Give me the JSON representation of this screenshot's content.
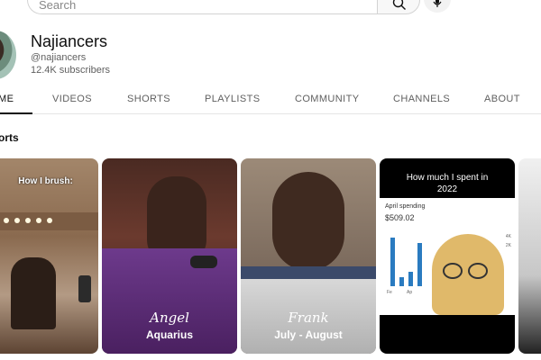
{
  "search": {
    "placeholder": "Search"
  },
  "channel": {
    "name": "Najiancers",
    "handle": "@najiancers",
    "subscribers": "12.4K subscribers"
  },
  "tabs": [
    {
      "label": "ME",
      "active": true
    },
    {
      "label": "VIDEOS",
      "active": false
    },
    {
      "label": "SHORTS",
      "active": false
    },
    {
      "label": "PLAYLISTS",
      "active": false
    },
    {
      "label": "COMMUNITY",
      "active": false
    },
    {
      "label": "CHANNELS",
      "active": false
    },
    {
      "label": "ABOUT",
      "active": false
    }
  ],
  "section": {
    "title": "orts"
  },
  "shorts": [
    {
      "overlay_top": "How I brush:"
    },
    {
      "overlay_script": "Angel",
      "overlay_bold": "Aquarius"
    },
    {
      "overlay_script": "Frank",
      "overlay_bold": "July - August"
    },
    {
      "overlay_top_line1": "How much I spent in",
      "overlay_top_line2": "2022",
      "inset_label": "April spending",
      "inset_amount": "$509.02",
      "inset_axis": [
        "Fe",
        "Ap"
      ],
      "inset_ticks": [
        "4K",
        "2K"
      ]
    }
  ],
  "colors": {
    "accent_bar": "#2a7bc0",
    "tab_active": "#0f0f0f",
    "tab_inactive": "#606060"
  }
}
